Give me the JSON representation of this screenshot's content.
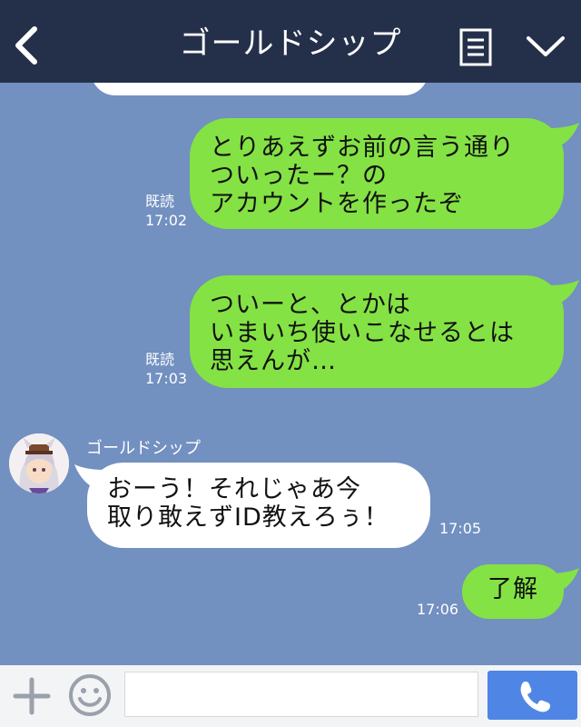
{
  "header": {
    "title": "ゴールドシップ",
    "back_icon": "chevron-left-icon",
    "menu_icon": "menu-icon",
    "collapse_icon": "chevron-down-icon"
  },
  "chat": {
    "messages": [
      {
        "from": "them",
        "text": ""
      },
      {
        "from": "me",
        "text": "とりあえずお前の言う通り\nついったー？の\nアカウントを作ったぞ",
        "read": "既読",
        "time": "17:02"
      },
      {
        "from": "me",
        "text": "ついーと、とかは\nいまいち使いこなせるとは\n思えんが…",
        "read": "既読",
        "time": "17:03"
      },
      {
        "from": "them",
        "sender": "ゴールドシップ",
        "text": "おーう！それじゃあ今\n取り敢えずID教えろぅ！",
        "time": "17:05"
      },
      {
        "from": "me",
        "text": "了解",
        "time": "17:06"
      }
    ]
  },
  "input_bar": {
    "plus_icon": "plus-icon",
    "emoji_icon": "smiley-icon",
    "message_value": "",
    "call_icon": "phone-icon"
  },
  "colors": {
    "header": "#24304a",
    "chat_background": "#7290c0",
    "my_bubble": "#84e244",
    "their_bubble": "#ffffff",
    "call_button": "#4f86e6"
  }
}
